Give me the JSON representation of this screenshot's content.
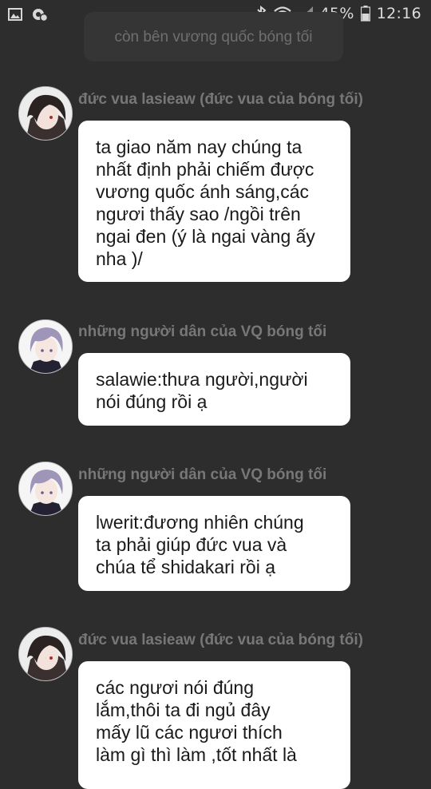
{
  "status_bar": {
    "battery": "45%",
    "time": "12:16",
    "icons": [
      "gallery-icon",
      "settings-notification-icon",
      "bluetooth-icon",
      "wifi-icon",
      "signal-icon",
      "battery-icon"
    ]
  },
  "header": {
    "text": "còn bên vương quốc bóng tối"
  },
  "messages": [
    {
      "sender": "đức vua lasieaw (đức vua của bóng tối)",
      "avatar": "dark-haired-avatar",
      "text": "ta giao năm nay chúng ta\nnhất định phải chiếm được\nvương quốc ánh sáng,các\nngươi thấy sao /ngồi trên\nngai đen (ý là ngai vàng ấy\nnha )/"
    },
    {
      "sender": "những người dân của VQ bóng tối",
      "avatar": "lilac-haired-avatar",
      "text": "salawie:thưa người,người\nnói đúng rồi ạ"
    },
    {
      "sender": "những người dân của VQ bóng tối",
      "avatar": "lilac-haired-avatar",
      "text": "lwerit:đương nhiên chúng\nta phải giúp đức vua và\nchúa tể shidakari rồi ạ"
    },
    {
      "sender": "đức vua lasieaw (đức vua của bóng tối)",
      "avatar": "dark-haired-avatar",
      "text": "các ngươi nói đúng\nlắm,thôi ta đi ngủ đây\nmấy lũ các ngươi thích\nlàm gì thì làm ,tốt nhất là"
    }
  ]
}
